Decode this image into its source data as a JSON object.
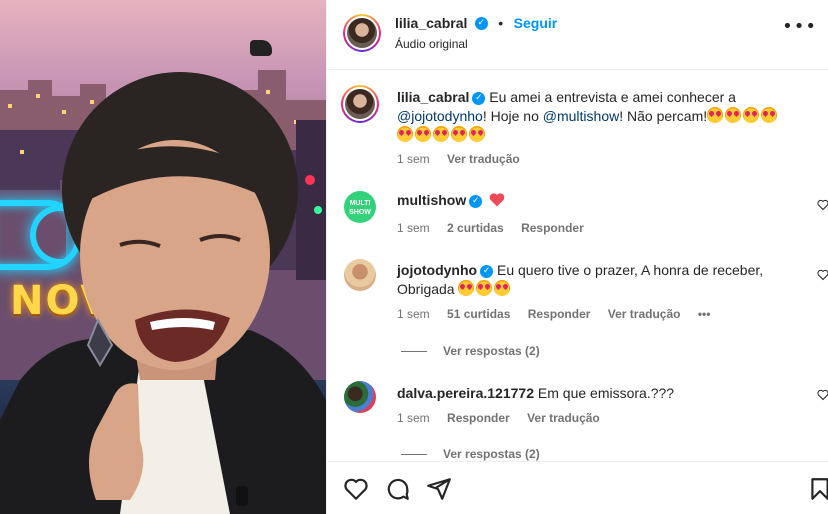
{
  "header": {
    "username": "lilia_cabral",
    "verified_mark": "✓",
    "separator": "•",
    "follow_label": "Seguir",
    "audio": "Áudio original",
    "more": "•••"
  },
  "caption": {
    "username": "lilia_cabral",
    "text_part1": "Eu amei a entrevista e amei conhecer a",
    "mention1": "@jojotodynho",
    "text_part2": "! Hoje no ",
    "mention2": "@multishow",
    "text_part3": "! Não percam!",
    "time": "1 sem",
    "translate": "Ver tradução"
  },
  "comments": [
    {
      "username": "multishow",
      "avatar_label": "MULTI SHOW",
      "time": "1 sem",
      "likes": "2 curtidas",
      "reply": "Responder"
    },
    {
      "username": "jojotodynho",
      "text": "Eu quero tive o prazer, A honra de receber,",
      "text2": "Obrigada",
      "time": "1 sem",
      "likes": "51 curtidas",
      "reply": "Responder",
      "translate": "Ver tradução",
      "more": "•••",
      "view_replies": "Ver respostas (2)"
    },
    {
      "username": "dalva.pereira.121772",
      "text": "Em que emissora.???",
      "time": "1 sem",
      "reply": "Responder",
      "translate": "Ver tradução",
      "view_replies": "Ver respostas (2)"
    }
  ],
  "media": {
    "sign_text": "NOVE"
  },
  "icons": [
    "like-icon",
    "comment-icon",
    "share-icon",
    "save-icon",
    "more-icon",
    "verified-icon",
    "heart-icon"
  ],
  "colors": {
    "accent": "#0095f6",
    "mention": "#00376b",
    "heart": "#ed4956",
    "muted": "#737373"
  }
}
